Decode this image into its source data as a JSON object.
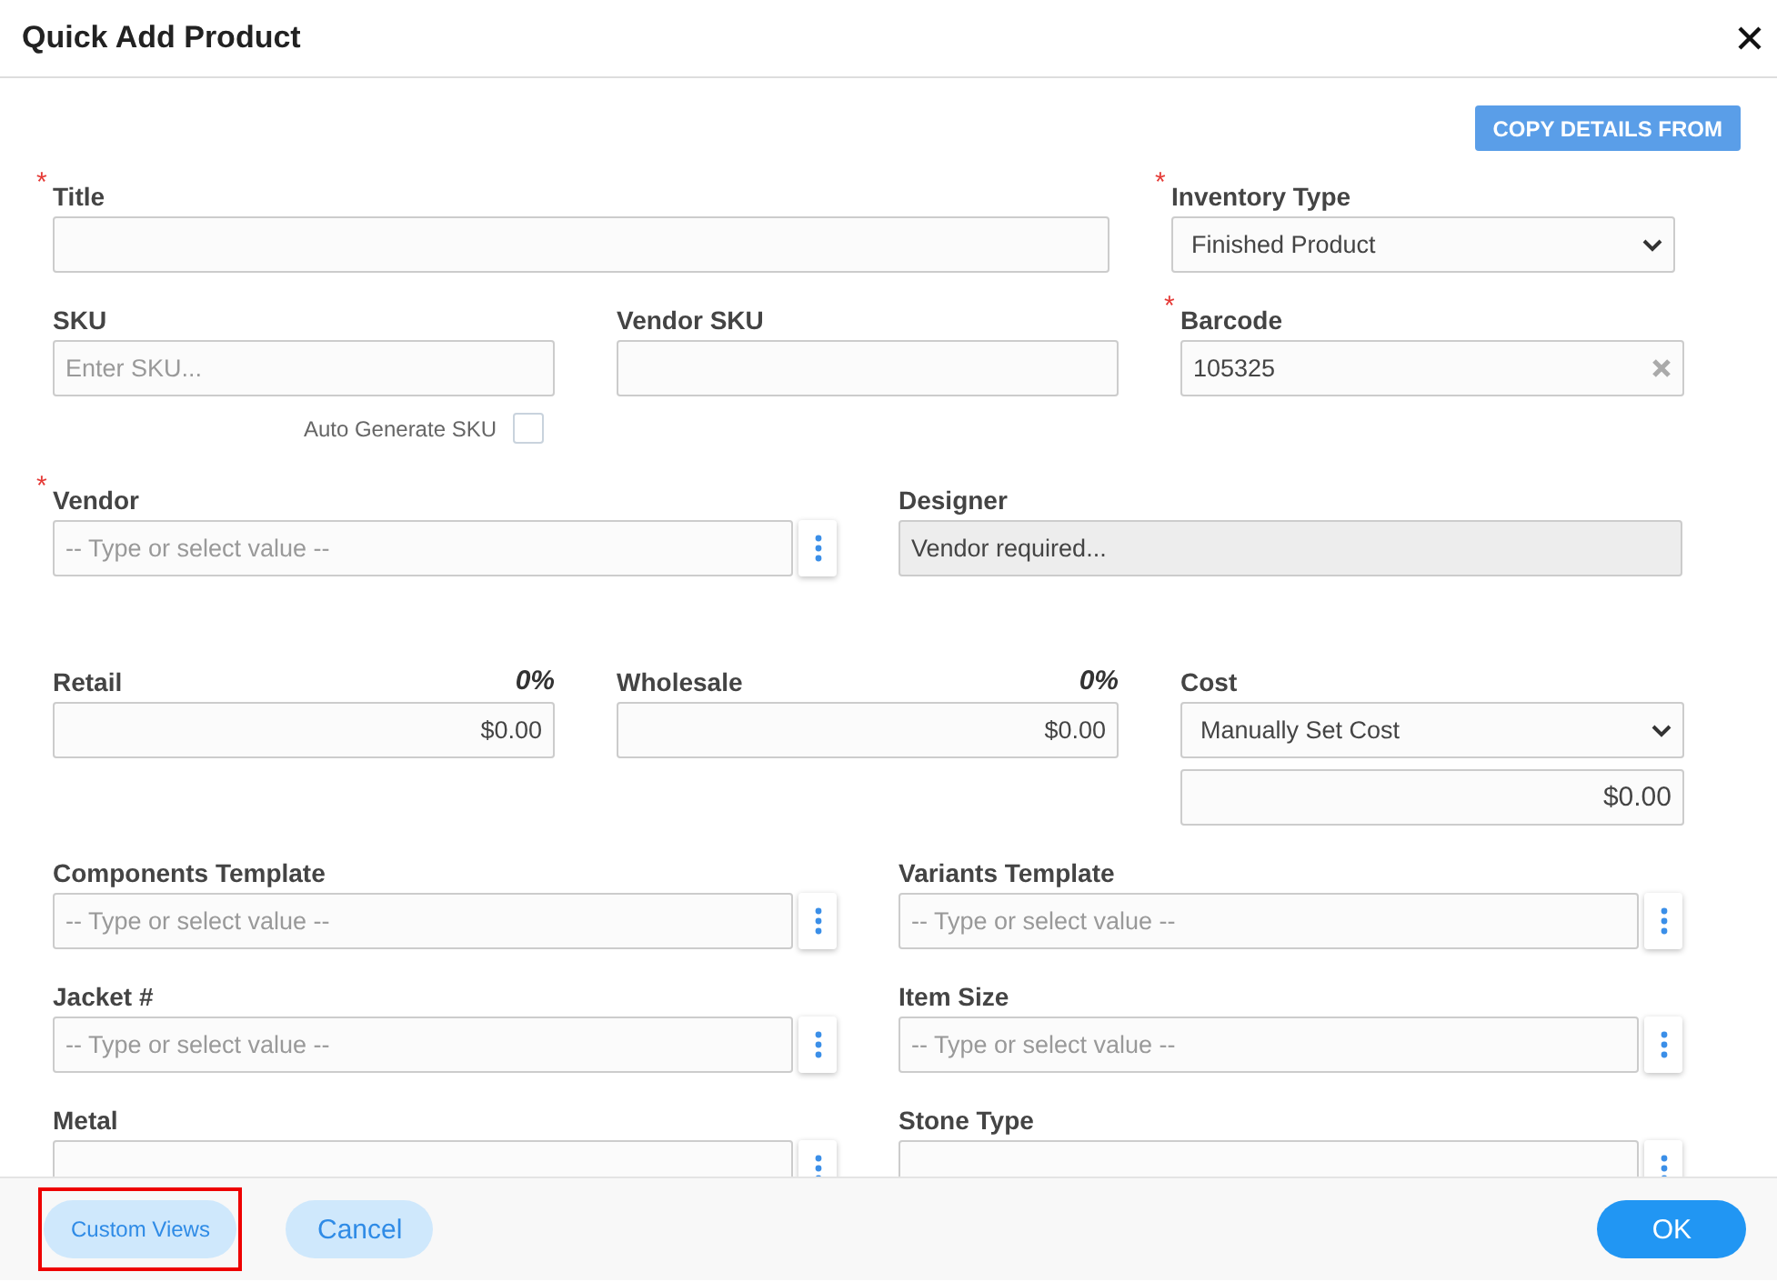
{
  "dialog": {
    "title": "Quick Add Product",
    "copy_button": "COPY DETAILS FROM"
  },
  "rows": [
    {
      "fields": [
        {
          "kind": "text",
          "label": "Title",
          "marker": "*"
        },
        {
          "kind": "select",
          "label": "Inventory Type",
          "marker": "*",
          "value": "Finished Product"
        }
      ]
    },
    {
      "fields": [
        {
          "kind": "text",
          "label": "SKU",
          "placeholder": "Enter SKU..."
        },
        {
          "kind": "text",
          "label": "Vendor SKU"
        },
        {
          "kind": "clearable",
          "label": "Barcode",
          "marker": "*",
          "value": "105325"
        }
      ],
      "option": {
        "label": "Auto Generate SKU",
        "checked": false
      }
    },
    {
      "fields": [
        {
          "kind": "lookup",
          "label": "Vendor",
          "marker": "*",
          "placeholder": "-- Type or select value --"
        },
        {
          "kind": "readonly",
          "label": "Designer",
          "value": "Vendor required..."
        }
      ]
    },
    {
      "fields": [
        {
          "kind": "money",
          "label": "Retail",
          "percent": "0%",
          "value": "$0.00"
        },
        {
          "kind": "money",
          "label": "Wholesale",
          "percent": "0%",
          "value": "$0.00"
        },
        {
          "kind": "cost",
          "label": "Cost",
          "value": "Manually Set Cost",
          "amount": "$0.00"
        }
      ]
    },
    {
      "fields": [
        {
          "kind": "lookup",
          "label": "Components Template",
          "placeholder": "-- Type or select value --"
        },
        {
          "kind": "lookup",
          "label": "Variants Template",
          "placeholder": "-- Type or select value --"
        }
      ]
    },
    {
      "fields": [
        {
          "kind": "lookup",
          "label": "Jacket #",
          "placeholder": "-- Type or select value --"
        },
        {
          "kind": "lookup",
          "label": "Item Size",
          "placeholder": "-- Type or select value --"
        }
      ]
    },
    {
      "fields": [
        {
          "kind": "lookup",
          "label": "Metal"
        },
        {
          "kind": "lookup",
          "label": "Stone Type"
        }
      ]
    }
  ],
  "footer": {
    "buttons": [
      {
        "label": "Custom Views",
        "kind": "secondary",
        "highlighted": true
      },
      {
        "label": "Cancel",
        "kind": "secondary"
      },
      {
        "label": "OK",
        "kind": "primary"
      }
    ]
  }
}
